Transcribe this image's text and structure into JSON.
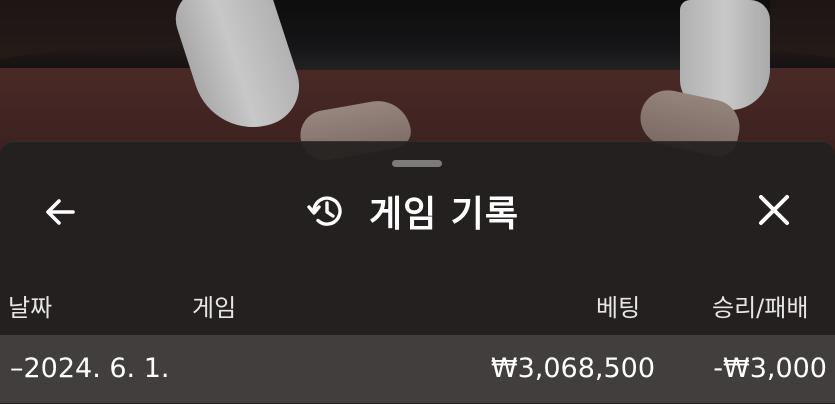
{
  "header": {
    "title": "게임 기록"
  },
  "icons": {
    "back": "arrow-left-icon",
    "history": "history-icon",
    "close": "close-icon"
  },
  "table": {
    "columns": [
      "날짜",
      "게임",
      "베팅",
      "승리/패배"
    ],
    "rows": [
      {
        "date": "–2024. 6. 1.",
        "game": "",
        "bet": "₩3,068,500",
        "result": "-₩3,000"
      }
    ]
  },
  "colors": {
    "panel": "#22201f",
    "row": "#464443",
    "text": "#ffffff"
  }
}
